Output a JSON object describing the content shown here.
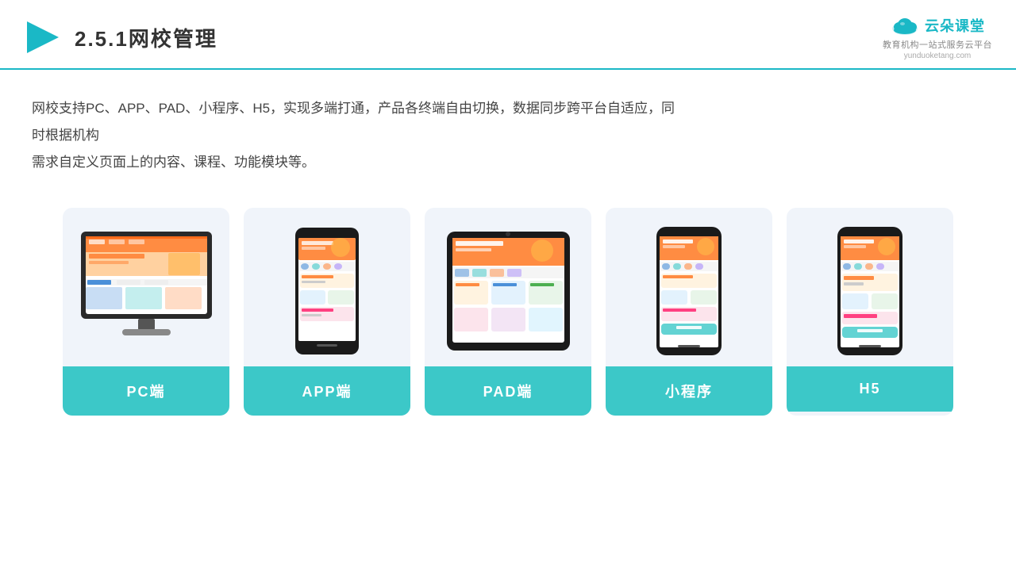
{
  "header": {
    "title": "2.5.1网校管理",
    "logo_main": "云朵课堂",
    "logo_url": "yunduoketang.com",
    "logo_tagline": "教育机构一站\n式服务云平台"
  },
  "description": {
    "text": "网校支持PC、APP、PAD、小程序、H5，实现多端打通，产品各终端自由切换，数据同步跨平台自适应，同时根据机构需求自定义页面上的内容、课程、功能模块等。"
  },
  "cards": [
    {
      "id": "pc",
      "label": "PC端",
      "device": "pc"
    },
    {
      "id": "app",
      "label": "APP端",
      "device": "phone"
    },
    {
      "id": "pad",
      "label": "PAD端",
      "device": "tablet"
    },
    {
      "id": "mini",
      "label": "小程序",
      "device": "phone"
    },
    {
      "id": "h5",
      "label": "H5",
      "device": "phone"
    }
  ],
  "colors": {
    "accent": "#3cc8c8",
    "title": "#333333",
    "text": "#444444",
    "card_bg": "#f0f4fa",
    "border_bottom": "#1ab8c6"
  }
}
